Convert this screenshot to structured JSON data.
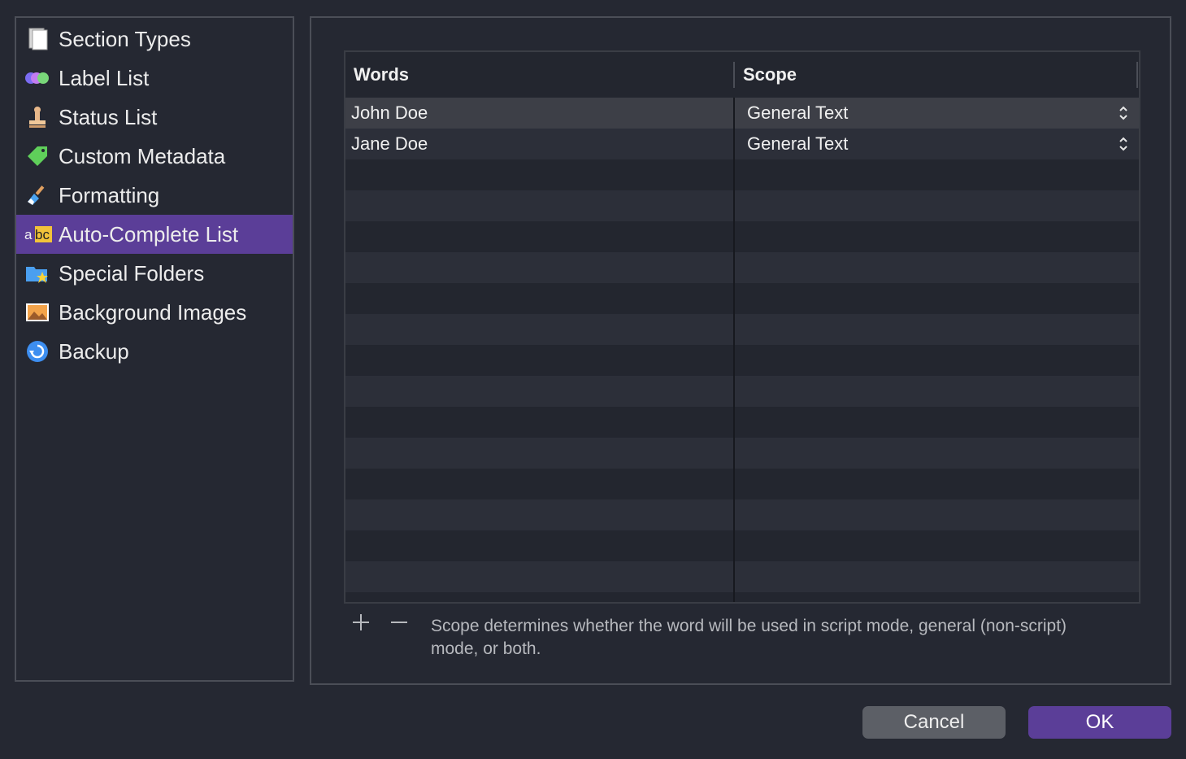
{
  "sidebar": {
    "items": [
      {
        "label": "Section Types",
        "icon": "section-types-icon"
      },
      {
        "label": "Label List",
        "icon": "label-list-icon"
      },
      {
        "label": "Status List",
        "icon": "status-stamp-icon"
      },
      {
        "label": "Custom Metadata",
        "icon": "tag-icon"
      },
      {
        "label": "Formatting",
        "icon": "paintbrush-icon"
      },
      {
        "label": "Auto-Complete List",
        "icon": "abc-icon",
        "selected": true
      },
      {
        "label": "Special Folders",
        "icon": "folder-star-icon"
      },
      {
        "label": "Background Images",
        "icon": "image-icon"
      },
      {
        "label": "Backup",
        "icon": "backup-icon"
      }
    ]
  },
  "table": {
    "headers": {
      "words": "Words",
      "scope": "Scope"
    },
    "rows": [
      {
        "word": "John Doe",
        "scope": "General Text"
      },
      {
        "word": "Jane Doe",
        "scope": "General Text"
      }
    ]
  },
  "hint": "Scope determines whether the word will be used in script mode, general (non-script) mode, or both.",
  "buttons": {
    "cancel": "Cancel",
    "ok": "OK"
  },
  "colors": {
    "accent": "#5b3e98",
    "background": "#252832"
  }
}
